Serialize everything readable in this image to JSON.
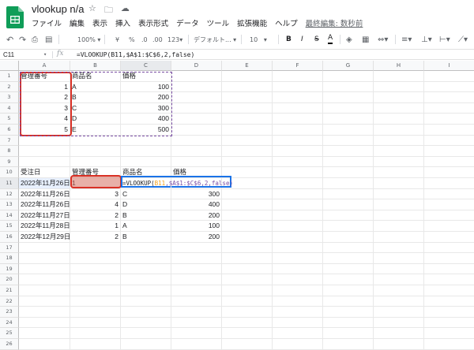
{
  "app": {
    "doc_title": "vlookup n/a",
    "title_icons": [
      "star-icon",
      "move-to-folder-icon",
      "cloud-status-icon"
    ],
    "menu": [
      "ファイル",
      "編集",
      "表示",
      "挿入",
      "表示形式",
      "データ",
      "ツール",
      "拡張機能",
      "ヘルプ"
    ],
    "last_edit": "最終編集: 数秒前",
    "brand_color": "#0f9d58"
  },
  "toolbar": {
    "zoom": "100%",
    "currency": "¥",
    "percent": "%",
    "dec_decrease": ".0",
    "dec_increase": ".00",
    "number_format": "123",
    "font_name": "デフォルト...",
    "font_size": "10",
    "bold": "B",
    "italic": "I",
    "strike": "S",
    "text_color": "A"
  },
  "formula_bar": {
    "name_box": "C11",
    "fx": "fx",
    "formula": "=VLOOKUP(B11,$A$1:$C$6,2,false)"
  },
  "columns": [
    "A",
    "B",
    "C",
    "D",
    "E",
    "F",
    "G",
    "H",
    "I"
  ],
  "rows": [
    "1",
    "2",
    "3",
    "4",
    "5",
    "6",
    "7",
    "8",
    "9",
    "10",
    "11",
    "12",
    "13",
    "14",
    "15",
    "16",
    "17",
    "18",
    "19",
    "20",
    "21",
    "22",
    "23",
    "24",
    "25",
    "26"
  ],
  "master": {
    "headers": [
      "管理番号",
      "商品名",
      "価格"
    ],
    "rows": [
      [
        "1",
        "A",
        "100"
      ],
      [
        "2",
        "B",
        "200"
      ],
      [
        "3",
        "C",
        "300"
      ],
      [
        "4",
        "D",
        "400"
      ],
      [
        "5",
        "E",
        "500"
      ]
    ]
  },
  "orders": {
    "headers": [
      "受注日",
      "管理番号",
      "商品名",
      "価格"
    ],
    "first_row": [
      "2022年11月26日",
      "1",
      "=VLOOKUP(",
      "B11",
      ",$A$1:$C$6,2,false)"
    ],
    "rows": [
      [
        "2022年11月26日",
        "3",
        "C",
        "300"
      ],
      [
        "2022年11月26日",
        "4",
        "D",
        "400"
      ],
      [
        "2022年11月27日",
        "2",
        "B",
        "200"
      ],
      [
        "2022年11月28日",
        "1",
        "A",
        "100"
      ],
      [
        "2022年12月29日",
        "2",
        "B",
        "200"
      ]
    ]
  }
}
